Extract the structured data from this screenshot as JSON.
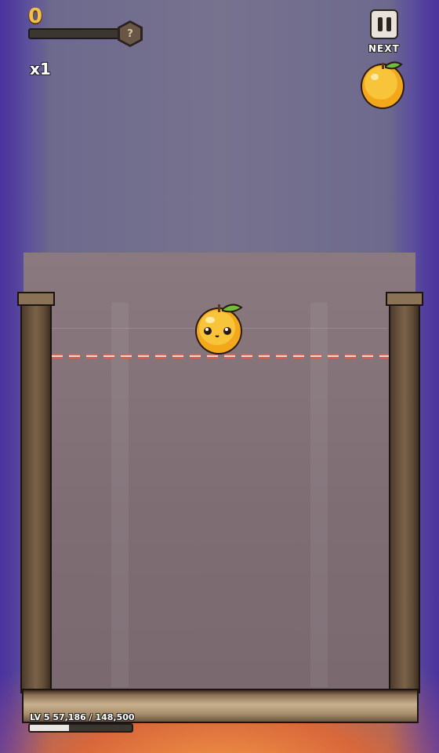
{
  "hud": {
    "score": "0",
    "score_progress": 0,
    "mystery_symbol": "?",
    "multiplier": "x1",
    "pause_icon": "pause-icon"
  },
  "next": {
    "label": "NEXT",
    "fruit": "lemon"
  },
  "board": {
    "current_fruit": "lemon",
    "danger_line": "dashed-red"
  },
  "level": {
    "text": "LV 5 57,186 / 148,500",
    "progress": 0.385
  },
  "colors": {
    "accent_gold": "#f1c04c",
    "danger": "#e06050",
    "lemon": "#f5b820"
  }
}
